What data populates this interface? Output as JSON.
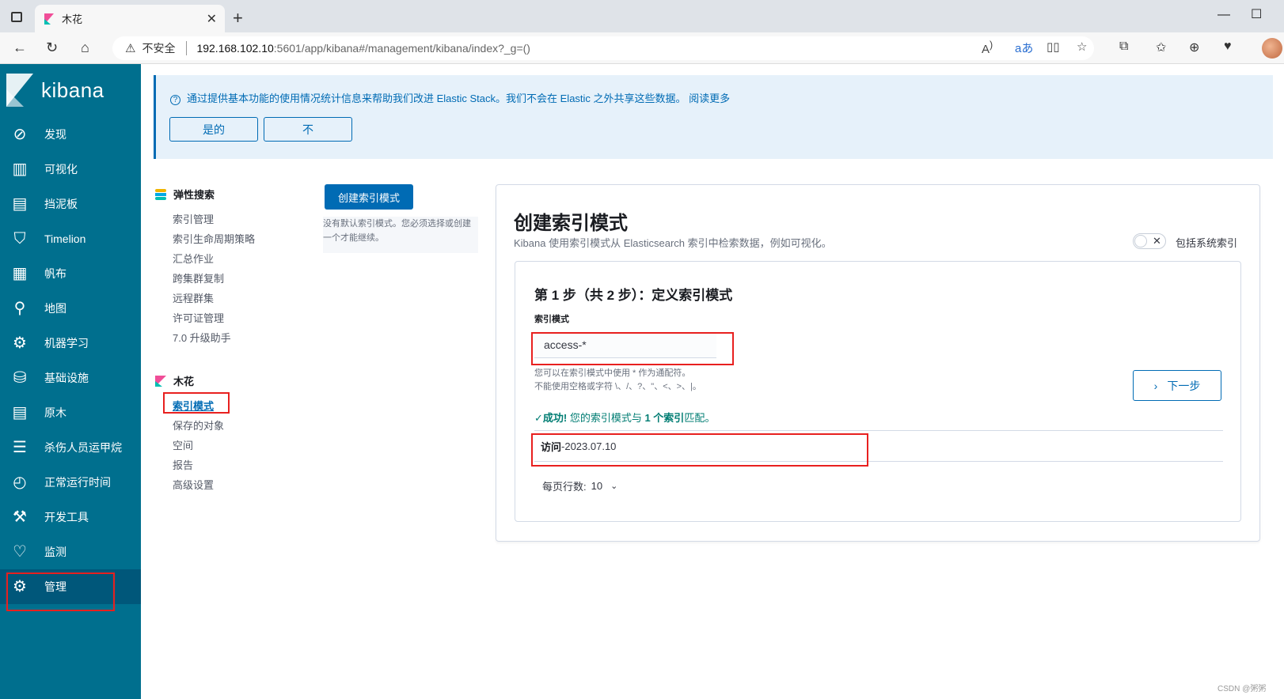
{
  "browser": {
    "tab_title": "木花",
    "tab_close": "✕",
    "new_tab": "+",
    "insecure_label": "不安全",
    "url_host": "192.168.102.10",
    "url_rest": ":5601/app/kibana#/management/kibana/index?_g=()",
    "warn_icon": "⚠"
  },
  "kibana": {
    "brand": "kibana",
    "nav": [
      {
        "label": "发现",
        "icon": "compass-icon"
      },
      {
        "label": "可视化",
        "icon": "visualize-icon"
      },
      {
        "label": "挡泥板",
        "icon": "dashboard-icon"
      },
      {
        "label": "Timelion",
        "icon": "timelion-icon"
      },
      {
        "label": "帆布",
        "icon": "canvas-icon"
      },
      {
        "label": "地图",
        "icon": "map-icon"
      },
      {
        "label": "机器学习",
        "icon": "ml-icon"
      },
      {
        "label": "基础设施",
        "icon": "infra-icon"
      },
      {
        "label": "原木",
        "icon": "logs-icon"
      },
      {
        "label": "杀伤人员运甲烷",
        "icon": "apm-icon"
      },
      {
        "label": "正常运行时间",
        "icon": "uptime-icon"
      },
      {
        "label": "开发工具",
        "icon": "devtools-icon"
      },
      {
        "label": "监测",
        "icon": "monitoring-icon"
      },
      {
        "label": "管理",
        "icon": "gear-icon"
      }
    ]
  },
  "banner": {
    "message": "通过提供基本功能的使用情况统计信息来帮助我们改进 Elastic Stack。我们不会在 Elastic 之外共享这些数据。 阅读更多",
    "yes_label": "是的",
    "no_label": "不"
  },
  "management": {
    "es_title": "弹性搜索",
    "es_links": [
      "索引管理",
      "索引生命周期策略",
      "汇总作业",
      "跨集群复制",
      "远程群集",
      "许可证管理",
      "7.0 升级助手"
    ],
    "kibana_title": "木花",
    "kibana_links": [
      "索引模式",
      "保存的对象",
      "空间",
      "报告",
      "高级设置"
    ]
  },
  "middle": {
    "create_label": "创建索引模式",
    "note": "没有默认索引模式。您必须选择或创建一个才能继续。"
  },
  "panel": {
    "title": "创建索引模式",
    "description": "Kibana 使用索引模式从 Elasticsearch 索引中检索数据，例如可视化。",
    "toggle_x": "✕",
    "toggle_label": "包括系统索引",
    "step_title": "第 1 步（共 2 步）：定义索引模式",
    "field_label": "索引模式",
    "input_value": "access-*",
    "help_line1": "您可以在索引模式中使用 * 作为通配符。",
    "help_line2": "不能使用空格或字符 \\、/、?、\"、<、>、|。",
    "success_prefix": "✓成功!",
    "success_text": " 您的索引模式与 ",
    "success_count": "1 个索引",
    "success_suffix": "匹配。",
    "next_label": "下一步",
    "index_bold": "访问",
    "index_rest": "-2023.07.10",
    "rows_label": "每页行数:",
    "rows_value": "10"
  },
  "watermark": "CSDN @粥粥"
}
